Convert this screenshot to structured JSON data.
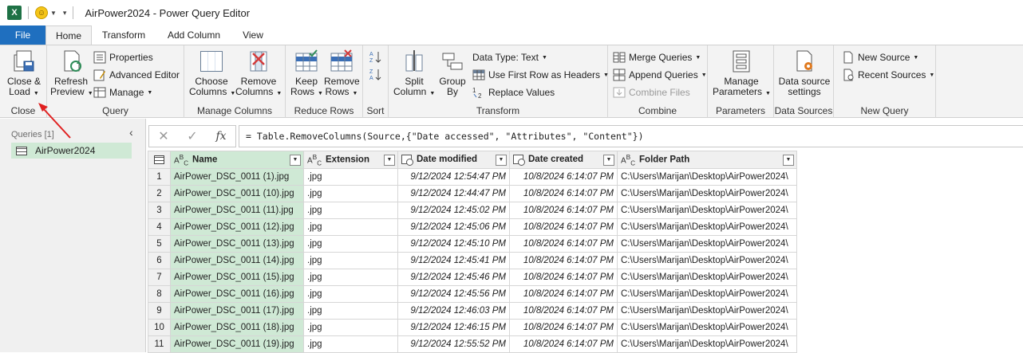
{
  "titlebar": {
    "app_icon": "X",
    "title": "AirPower2024 - Power Query Editor"
  },
  "tabs": [
    "File",
    "Home",
    "Transform",
    "Add Column",
    "View"
  ],
  "ribbon": {
    "close": {
      "btn_line1": "Close &",
      "btn_line2": "Load",
      "label": "Close"
    },
    "query": {
      "refresh_line1": "Refresh",
      "refresh_line2": "Preview",
      "properties": "Properties",
      "advanced_editor": "Advanced Editor",
      "manage": "Manage",
      "label": "Query"
    },
    "manage_columns": {
      "choose_line1": "Choose",
      "choose_line2": "Columns",
      "remove_line1": "Remove",
      "remove_line2": "Columns",
      "label": "Manage Columns"
    },
    "reduce_rows": {
      "keep_line1": "Keep",
      "keep_line2": "Rows",
      "remove_line1": "Remove",
      "remove_line2": "Rows",
      "label": "Reduce Rows"
    },
    "sort": {
      "label": "Sort"
    },
    "transform": {
      "split_line1": "Split",
      "split_line2": "Column",
      "group_line1": "Group",
      "group_line2": "By",
      "data_type": "Data Type: Text",
      "first_row": "Use First Row as Headers",
      "replace": "Replace Values",
      "label": "Transform"
    },
    "combine": {
      "merge": "Merge Queries",
      "append": "Append Queries",
      "combine_files": "Combine Files",
      "label": "Combine"
    },
    "parameters": {
      "manage_line1": "Manage",
      "manage_line2": "Parameters",
      "label": "Parameters"
    },
    "data_sources": {
      "btn_line1": "Data source",
      "btn_line2": "settings",
      "label": "Data Sources"
    },
    "new_query": {
      "new_source": "New Source",
      "recent_sources": "Recent Sources",
      "label": "New Query"
    }
  },
  "queries_pane": {
    "header": "Queries [1]",
    "items": [
      "AirPower2024"
    ]
  },
  "formula_bar": {
    "formula": "= Table.RemoveColumns(Source,{\"Date accessed\", \"Attributes\", \"Content\"})"
  },
  "grid": {
    "columns": [
      {
        "type": "ABC",
        "name": "Name"
      },
      {
        "type": "ABC",
        "name": "Extension"
      },
      {
        "type": "date",
        "name": "Date modified"
      },
      {
        "type": "date",
        "name": "Date created"
      },
      {
        "type": "ABC",
        "name": "Folder Path"
      }
    ],
    "rows": [
      [
        "1",
        "AirPower_DSC_0011 (1).jpg",
        ".jpg",
        "9/12/2024 12:54:47 PM",
        "10/8/2024 6:14:07 PM",
        "C:\\Users\\Marijan\\Desktop\\AirPower2024\\"
      ],
      [
        "2",
        "AirPower_DSC_0011 (10).jpg",
        ".jpg",
        "9/12/2024 12:44:47 PM",
        "10/8/2024 6:14:07 PM",
        "C:\\Users\\Marijan\\Desktop\\AirPower2024\\"
      ],
      [
        "3",
        "AirPower_DSC_0011 (11).jpg",
        ".jpg",
        "9/12/2024 12:45:02 PM",
        "10/8/2024 6:14:07 PM",
        "C:\\Users\\Marijan\\Desktop\\AirPower2024\\"
      ],
      [
        "4",
        "AirPower_DSC_0011 (12).jpg",
        ".jpg",
        "9/12/2024 12:45:06 PM",
        "10/8/2024 6:14:07 PM",
        "C:\\Users\\Marijan\\Desktop\\AirPower2024\\"
      ],
      [
        "5",
        "AirPower_DSC_0011 (13).jpg",
        ".jpg",
        "9/12/2024 12:45:10 PM",
        "10/8/2024 6:14:07 PM",
        "C:\\Users\\Marijan\\Desktop\\AirPower2024\\"
      ],
      [
        "6",
        "AirPower_DSC_0011 (14).jpg",
        ".jpg",
        "9/12/2024 12:45:41 PM",
        "10/8/2024 6:14:07 PM",
        "C:\\Users\\Marijan\\Desktop\\AirPower2024\\"
      ],
      [
        "7",
        "AirPower_DSC_0011 (15).jpg",
        ".jpg",
        "9/12/2024 12:45:46 PM",
        "10/8/2024 6:14:07 PM",
        "C:\\Users\\Marijan\\Desktop\\AirPower2024\\"
      ],
      [
        "8",
        "AirPower_DSC_0011 (16).jpg",
        ".jpg",
        "9/12/2024 12:45:56 PM",
        "10/8/2024 6:14:07 PM",
        "C:\\Users\\Marijan\\Desktop\\AirPower2024\\"
      ],
      [
        "9",
        "AirPower_DSC_0011 (17).jpg",
        ".jpg",
        "9/12/2024 12:46:03 PM",
        "10/8/2024 6:14:07 PM",
        "C:\\Users\\Marijan\\Desktop\\AirPower2024\\"
      ],
      [
        "10",
        "AirPower_DSC_0011 (18).jpg",
        ".jpg",
        "9/12/2024 12:46:15 PM",
        "10/8/2024 6:14:07 PM",
        "C:\\Users\\Marijan\\Desktop\\AirPower2024\\"
      ],
      [
        "11",
        "AirPower_DSC_0011 (19).jpg",
        ".jpg",
        "9/12/2024 12:55:52 PM",
        "10/8/2024 6:14:07 PM",
        "C:\\Users\\Marijan\\Desktop\\AirPower2024\\"
      ]
    ]
  },
  "colors": {
    "file_tab": "#1f6fbf",
    "selected_column": "#cfe9d5",
    "excel_green": "#1e7145",
    "annotation_arrow": "#e02020"
  },
  "icons": [
    "excel-icon",
    "smiley-icon",
    "close-load-icon",
    "refresh-icon",
    "properties-icon",
    "advanced-editor-icon",
    "manage-icon",
    "choose-columns-icon",
    "remove-columns-icon",
    "keep-rows-icon",
    "remove-rows-icon",
    "sort-ascending-icon",
    "sort-descending-icon",
    "split-column-icon",
    "group-by-icon",
    "data-type-icon",
    "first-row-headers-icon",
    "replace-values-icon",
    "merge-queries-icon",
    "append-queries-icon",
    "combine-files-icon",
    "manage-parameters-icon",
    "data-source-settings-icon",
    "new-source-icon",
    "recent-sources-icon"
  ]
}
